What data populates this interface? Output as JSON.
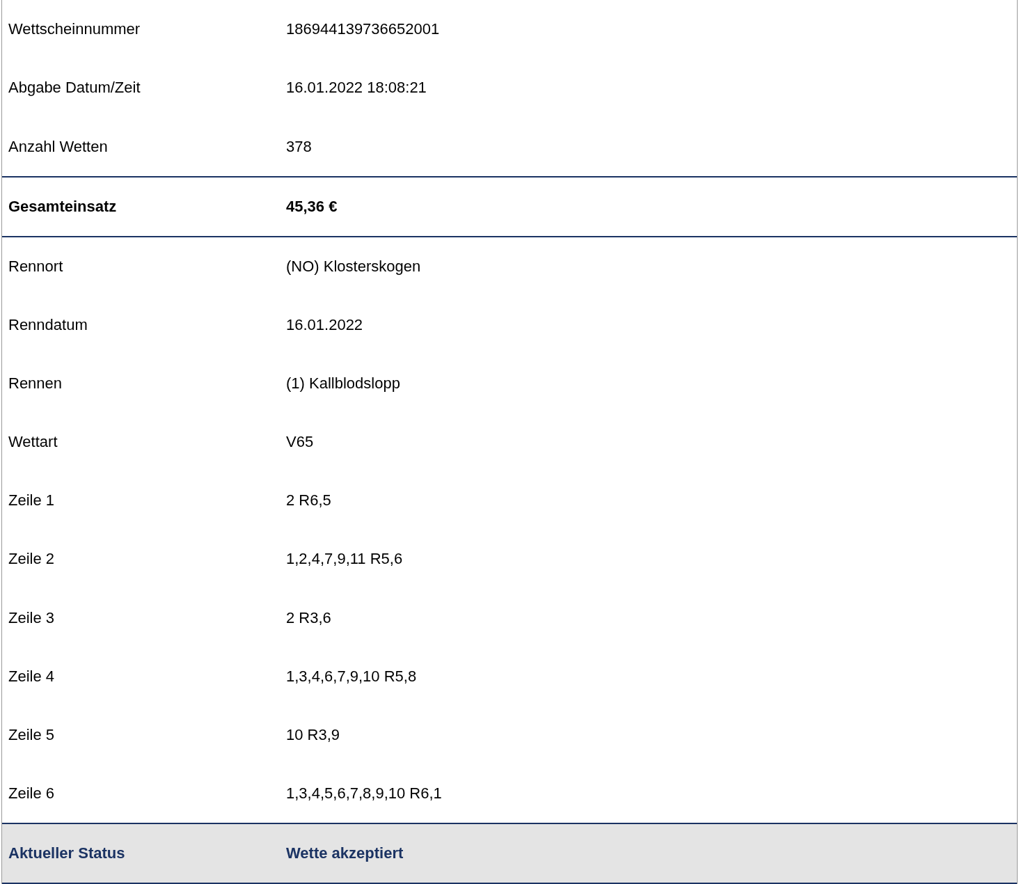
{
  "sections": [
    {
      "kind": "details",
      "rows": [
        {
          "label": "Wettscheinnummer",
          "value": "186944139736652001"
        },
        {
          "label": "Abgabe Datum/Zeit",
          "value": "16.01.2022 18:08:21"
        },
        {
          "label": "Anzahl Wetten",
          "value": "378"
        }
      ]
    },
    {
      "kind": "total",
      "rows": [
        {
          "label": "Gesamteinsatz",
          "value": "45,36 €"
        }
      ]
    },
    {
      "kind": "details",
      "rows": [
        {
          "label": "Rennort",
          "value": "(NO) Klosterskogen"
        },
        {
          "label": "Renndatum",
          "value": "16.01.2022"
        },
        {
          "label": "Rennen",
          "value": "(1) Kallblodslopp"
        },
        {
          "label": "Wettart",
          "value": "V65"
        },
        {
          "label": "Zeile 1",
          "value": "2 R6,5"
        },
        {
          "label": "Zeile 2",
          "value": "1,2,4,7,9,11 R5,6"
        },
        {
          "label": "Zeile 3",
          "value": "2 R3,6"
        },
        {
          "label": "Zeile 4",
          "value": "1,3,4,6,7,9,10 R5,8"
        },
        {
          "label": "Zeile 5",
          "value": "10 R3,9"
        },
        {
          "label": "Zeile 6",
          "value": "1,3,4,5,6,7,8,9,10 R6,1"
        }
      ]
    },
    {
      "kind": "status",
      "rows": [
        {
          "label": "Aktueller Status",
          "value": "Wette akzeptiert"
        }
      ]
    }
  ]
}
